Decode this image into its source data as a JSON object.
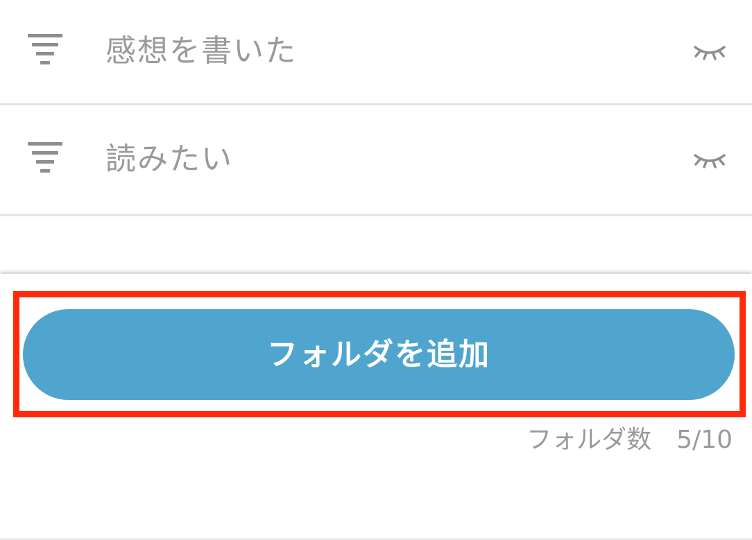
{
  "folders": [
    {
      "name": "感想を書いた",
      "visibility_icon": "eye-closed-icon",
      "handle_icon": "drag-handle-icon"
    },
    {
      "name": "読みたい",
      "visibility_icon": "eye-closed-icon",
      "handle_icon": "drag-handle-icon"
    }
  ],
  "add_button": {
    "label": "フォルダを追加",
    "color": "#4fa5ce",
    "highlight_color": "#ff2a0a"
  },
  "folder_count": {
    "label": "フォルダ数",
    "value": "5/10"
  }
}
